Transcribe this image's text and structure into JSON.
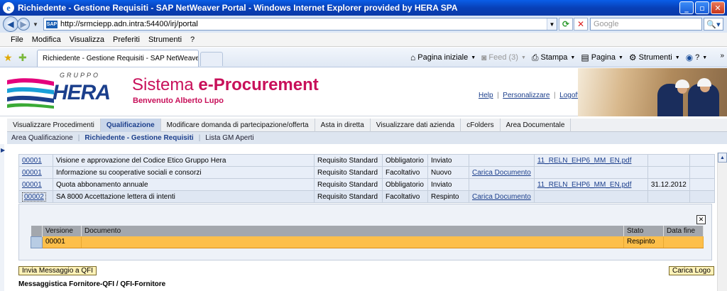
{
  "window": {
    "title": "Richiedente - Gestione Requisiti - SAP NetWeaver Portal - Windows Internet Explorer provided by HERA SPA",
    "min_glyph": "_",
    "max_glyph": "▫",
    "close_glyph": "✕"
  },
  "addressbar": {
    "url": "http://srmciepp.adn.intra:54400/irj/portal",
    "search_placeholder": "Google"
  },
  "menubar": [
    "File",
    "Modifica",
    "Visualizza",
    "Preferiti",
    "Strumenti",
    "?"
  ],
  "browser_tab": {
    "label": "Richiedente - Gestione Requisiti - SAP NetWeaver Portal"
  },
  "commandbar": {
    "home": "Pagina iniziale",
    "feed": "Feed (3)",
    "print": "Stampa",
    "page": "Pagina",
    "tools": "Strumenti",
    "help": "?"
  },
  "header": {
    "logo_gruppo": "GRUPPO",
    "logo_hera": "HERA",
    "title_normal": "Sistema ",
    "title_bold": "e-Procurement",
    "welcome": "Benvenuto Alberto Lupo",
    "links": {
      "help": "Help",
      "personalize": "Personalizzare",
      "logoff": "Logoff"
    }
  },
  "topnav": [
    "Visualizzare Procedimenti",
    "Qualificazione",
    "Modificare domanda di partecipazione/offerta",
    "Asta in diretta",
    "Visualizzare dati azienda",
    "cFolders",
    "Area Documentale"
  ],
  "subnav": {
    "items": [
      "Area Qualificazione",
      "Richiedente - Gestione Requisiti",
      "Lista GM Aperti"
    ]
  },
  "requirements": [
    {
      "id": "00001",
      "name": "Visione e approvazione del Codice Etico Gruppo Hera",
      "type": "Requisito Standard",
      "obligation": "Obbligatorio",
      "status": "Inviato",
      "action": "",
      "file": "11_RELN_EHP6_MM_EN.pdf",
      "date": ""
    },
    {
      "id": "00001",
      "name": "Informazione su cooperative sociali e consorzi",
      "type": "Requisito Standard",
      "obligation": "Facoltativo",
      "status": "Nuovo",
      "action": "Carica Documento",
      "file": "",
      "date": ""
    },
    {
      "id": "00001",
      "name": "Quota abbonamento annuale",
      "type": "Requisito Standard",
      "obligation": "Obbligatorio",
      "status": "Inviato",
      "action": "",
      "file": "11_RELN_EHP6_MM_EN.pdf",
      "date": "31.12.2012"
    },
    {
      "id": "00002",
      "name": "SA 8000 Accettazione lettera di intenti",
      "type": "Requisito Standard",
      "obligation": "Facoltativo",
      "status": "Respinto",
      "action": "Carica Documento",
      "file": "",
      "date": ""
    }
  ],
  "detail": {
    "close_glyph": "✕",
    "headers": {
      "versione": "Versione",
      "documento": "Documento",
      "stato": "Stato",
      "data_fine": "Data fine"
    },
    "row": {
      "versione": "00001",
      "documento": "",
      "stato": "Respinto",
      "data_fine": ""
    }
  },
  "buttons": {
    "send_qfi": "Invia Messaggio a QFI",
    "upload_logo": "Carica Logo"
  },
  "messages_title": "Messaggistica Fornitore-QFI / QFI-Fornitore",
  "colors": {
    "titlebar": "#0a5ee8",
    "brand_magenta": "#c8105a",
    "brand_blue": "#1b3f8c",
    "selected_row": "#fdbf4a"
  }
}
